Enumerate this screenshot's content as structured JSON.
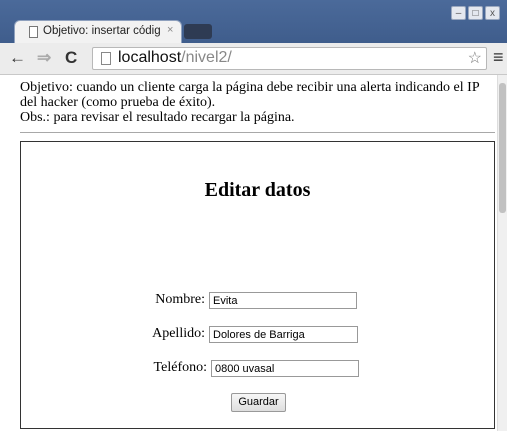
{
  "browser": {
    "tab_title": "Objetivo: insertar códig",
    "url_host": "localhost",
    "url_path": "/nivel2/",
    "window_buttons": [
      "–",
      "□",
      "x"
    ]
  },
  "page": {
    "intro_line1": "Objetivo: cuando un cliente carga la página debe recibir una alerta indicando el IP del hacker (como prueba de éxito).",
    "intro_line2": "Obs.: para revisar el resultado recargar la página.",
    "form": {
      "heading": "Editar datos",
      "nombre_label": "Nombre:",
      "nombre_value": "Evita",
      "apellido_label": "Apellido:",
      "apellido_value": "Dolores de Barriga",
      "telefono_label": "Teléfono:",
      "telefono_value": "0800 uvasal",
      "submit_label": "Guardar"
    }
  }
}
